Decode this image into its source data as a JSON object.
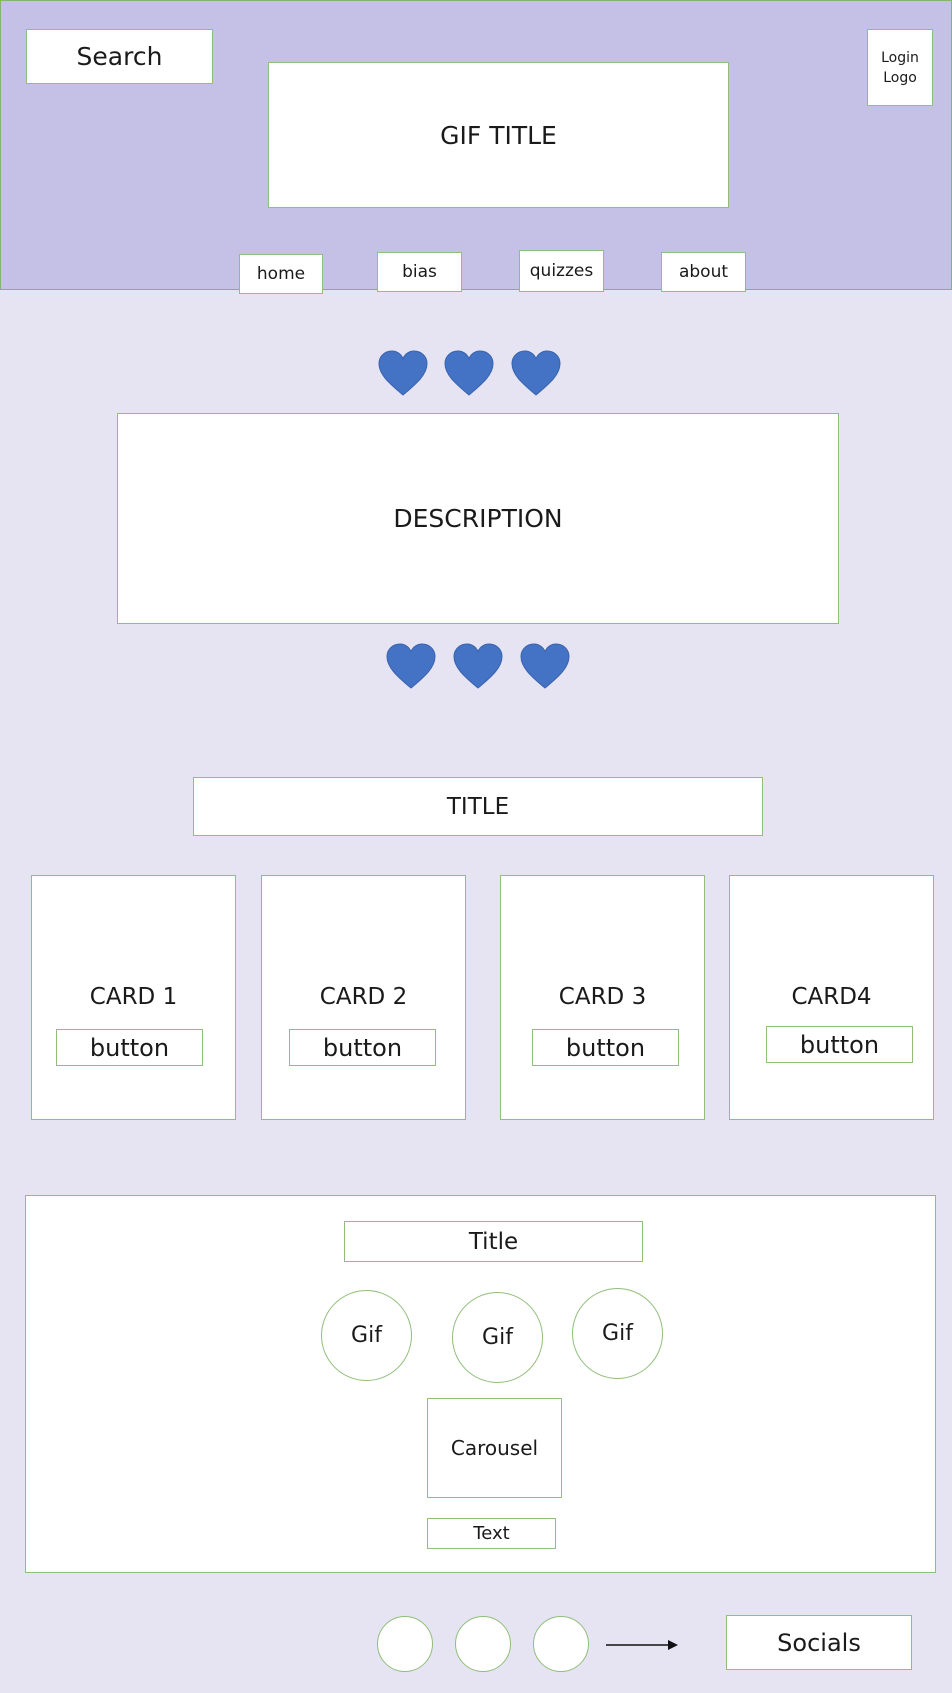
{
  "colors": {
    "header_bg": "#c5c0e6",
    "page_bg": "#e6e4f3",
    "border": "#8fbf7a",
    "heart": "#4472c4"
  },
  "header": {
    "search_label": "Search",
    "gif_title": "GIF TITLE",
    "login_logo_line1": "Login",
    "login_logo_line2": "Logo",
    "nav": {
      "home": "home",
      "bias": "bias",
      "quizzes": "quizzes",
      "about": "about"
    }
  },
  "hero": {
    "description": "DESCRIPTION",
    "heart_icon": "heart-icon"
  },
  "cards_section": {
    "title": "TITLE",
    "cards": [
      {
        "label": "CARD 1",
        "button": "button"
      },
      {
        "label": "CARD 2",
        "button": "button"
      },
      {
        "label": "CARD 3",
        "button": "button"
      },
      {
        "label": "CARD4",
        "button": "button"
      }
    ]
  },
  "gif_section": {
    "title": "Title",
    "gifs": [
      "Gif",
      "Gif",
      "Gif"
    ],
    "carousel": "Carousel",
    "text": "Text"
  },
  "footer": {
    "socials": "Socials"
  }
}
